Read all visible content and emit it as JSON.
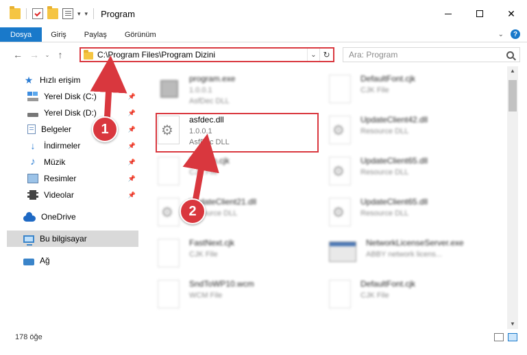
{
  "window": {
    "title": "Program",
    "minimize_label": "",
    "close_label": "✕"
  },
  "ribbon": {
    "tabs": [
      {
        "label": "Dosya"
      },
      {
        "label": "Giriş"
      },
      {
        "label": "Paylaş"
      },
      {
        "label": "Görünüm"
      }
    ],
    "help_label": "?"
  },
  "address": {
    "path": "C:\\Program Files\\Program Dizini",
    "search_placeholder": "Ara: Program"
  },
  "sidebar": {
    "quick_access": "Hızlı erişim",
    "items": [
      {
        "label": "Yerel Disk (C:)"
      },
      {
        "label": "Yerel Disk (D:)"
      },
      {
        "label": "Belgeler"
      },
      {
        "label": "İndirmeler"
      },
      {
        "label": "Müzik"
      },
      {
        "label": "Resimler"
      },
      {
        "label": "Videolar"
      }
    ],
    "onedrive": "OneDrive",
    "this_pc": "Bu bilgisayar",
    "network": "Ağ"
  },
  "files": {
    "left": [
      {
        "name": "program.exe",
        "line2": "1.0.0.1",
        "line3": "AsfDec DLL"
      },
      {
        "name": "asfdec.dll",
        "line2": "1.0.0.1",
        "line3": "AsfDec DLL"
      },
      {
        "name": "Boldten.cjk",
        "line2": "CJK File"
      },
      {
        "name": "UpdateClient21.dll",
        "line2": "Resource DLL"
      },
      {
        "name": "FastNext.cjk",
        "line2": "CJK File"
      },
      {
        "name": "SndToWP10.wcm",
        "line2": "WCM File"
      }
    ],
    "right": [
      {
        "name": "DefaultFont.cjk",
        "line2": "CJK File"
      },
      {
        "name": "UpdateClient42.dll",
        "line2": "Resource DLL"
      },
      {
        "name": "UpdateClient65.dll",
        "line2": "Resource DLL"
      },
      {
        "name": "UpdateClient65.dll",
        "line2": "Resource DLL"
      },
      {
        "name": "NetworkLicenseServer.exe",
        "line2": "ABBY network licens..."
      },
      {
        "name": "DefaultFont.cjk",
        "line2": "CJK File"
      }
    ]
  },
  "status": {
    "count": "178 öğe"
  },
  "annotations": {
    "step1": "1",
    "step2": "2"
  },
  "colors": {
    "accent": "#1979ca",
    "highlight": "#d9373e"
  }
}
